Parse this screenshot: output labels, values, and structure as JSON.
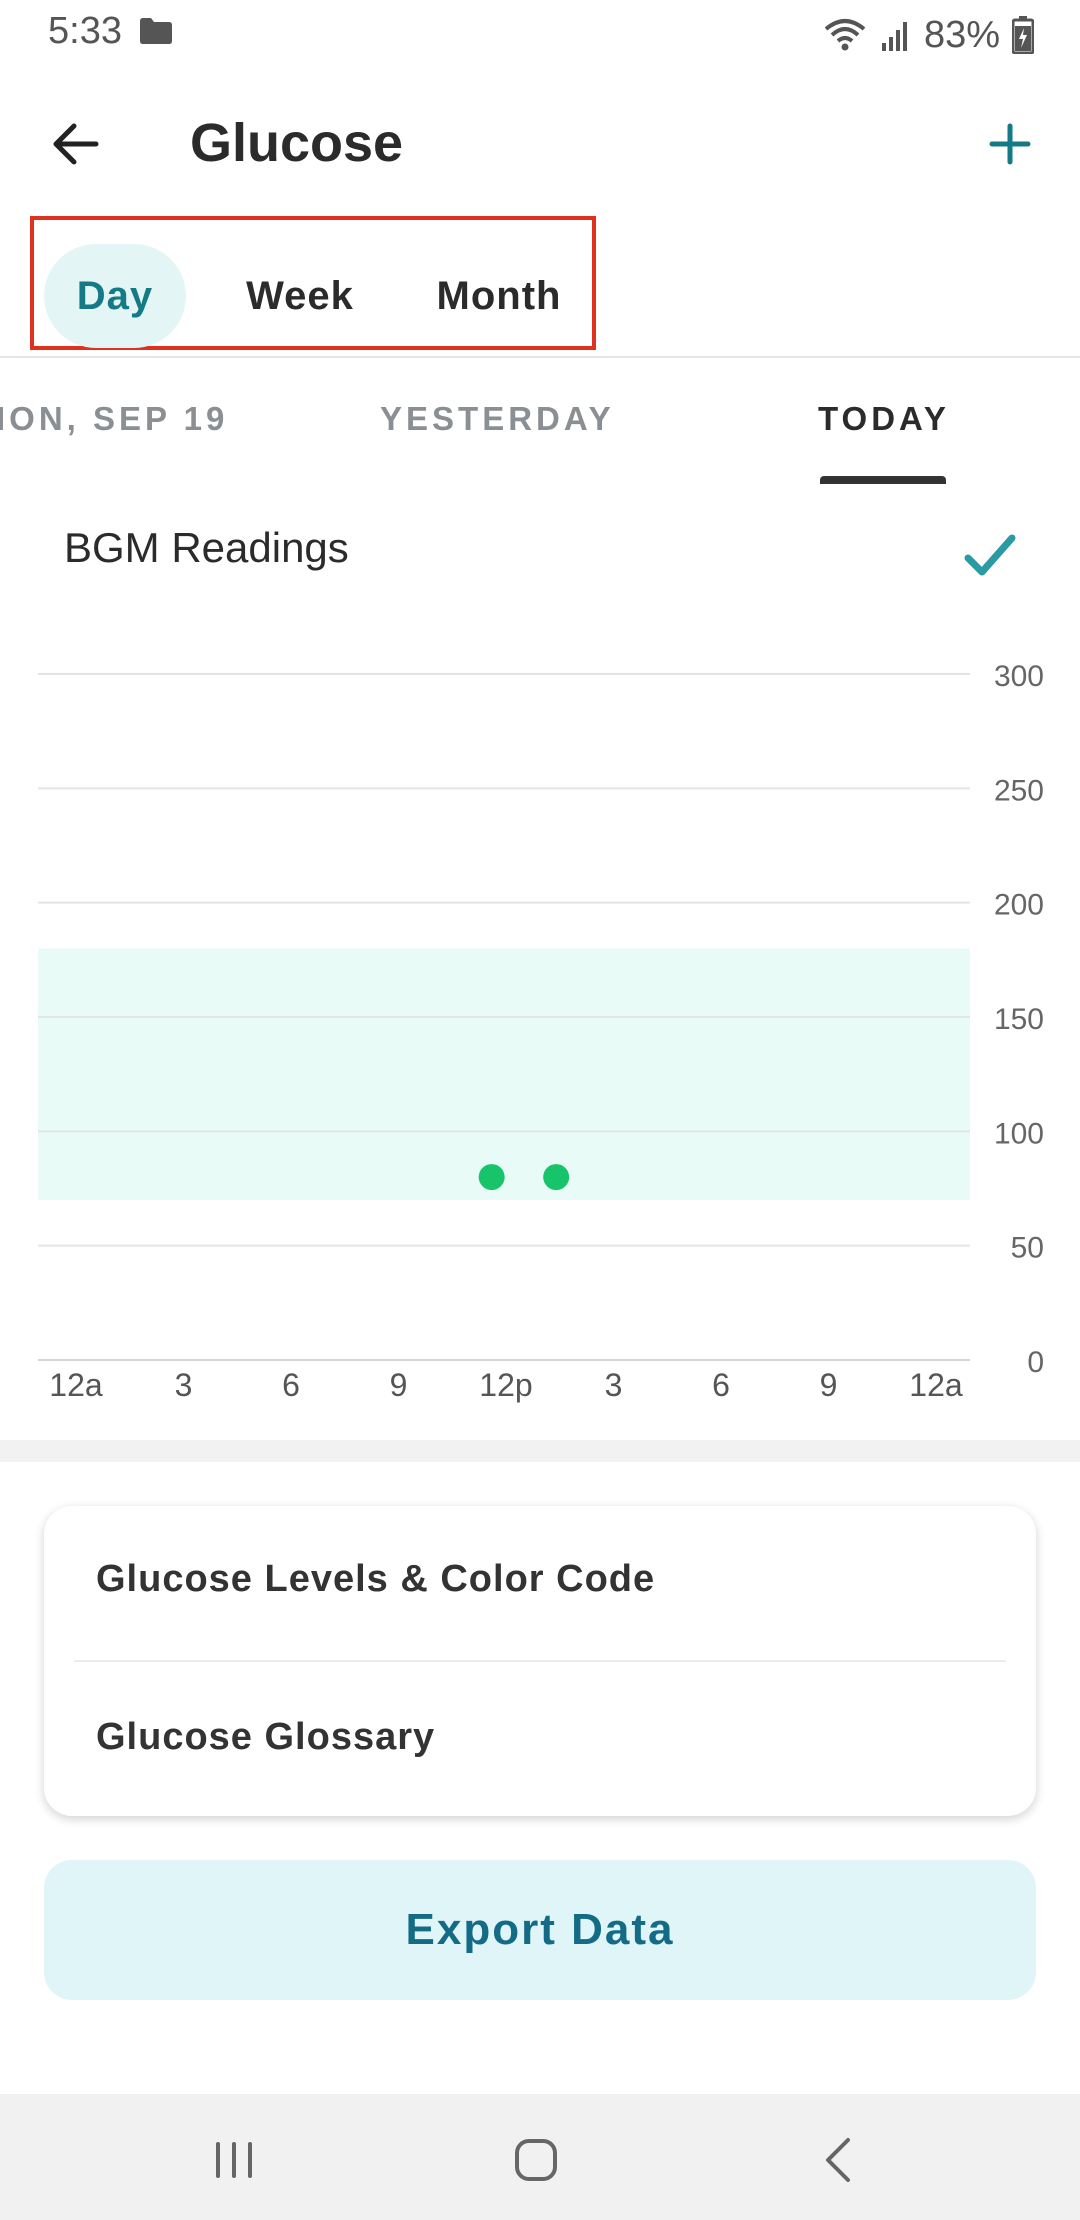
{
  "status_bar": {
    "time": "5:33",
    "battery": "83%"
  },
  "header": {
    "title": "Glucose"
  },
  "range_tabs": [
    {
      "label": "Day",
      "active": true
    },
    {
      "label": "Week",
      "active": false
    },
    {
      "label": "Month",
      "active": false
    }
  ],
  "date_tabs": [
    {
      "label": "ION, SEP 19",
      "active": false
    },
    {
      "label": "YESTERDAY",
      "active": false
    },
    {
      "label": "TODAY",
      "active": true
    }
  ],
  "chart": {
    "title": "BGM Readings"
  },
  "chart_data": {
    "type": "scatter",
    "title": "BGM Readings",
    "ylim": [
      0,
      300
    ],
    "yticks": [
      "300",
      "250",
      "200",
      "150",
      "100",
      "50",
      "0"
    ],
    "xticks": [
      "12a",
      "3",
      "6",
      "9",
      "12p",
      "3",
      "6",
      "9",
      "12a"
    ],
    "x_unit": "hours since midnight",
    "xlim": [
      0,
      24
    ],
    "target_range": [
      70,
      180
    ],
    "points": [
      {
        "x": 11.6,
        "y": 80
      },
      {
        "x": 13.4,
        "y": 80
      }
    ],
    "grid": true,
    "colors": {
      "points": "#18c46a",
      "range": "#e9fbf6",
      "grid": "#e4e4e4"
    }
  },
  "info_card": {
    "items": [
      "Glucose Levels & Color Code",
      "Glucose Glossary"
    ]
  },
  "export": {
    "label": "Export Data"
  },
  "colors": {
    "accent": "#137a86",
    "highlight": "#e0301e"
  }
}
